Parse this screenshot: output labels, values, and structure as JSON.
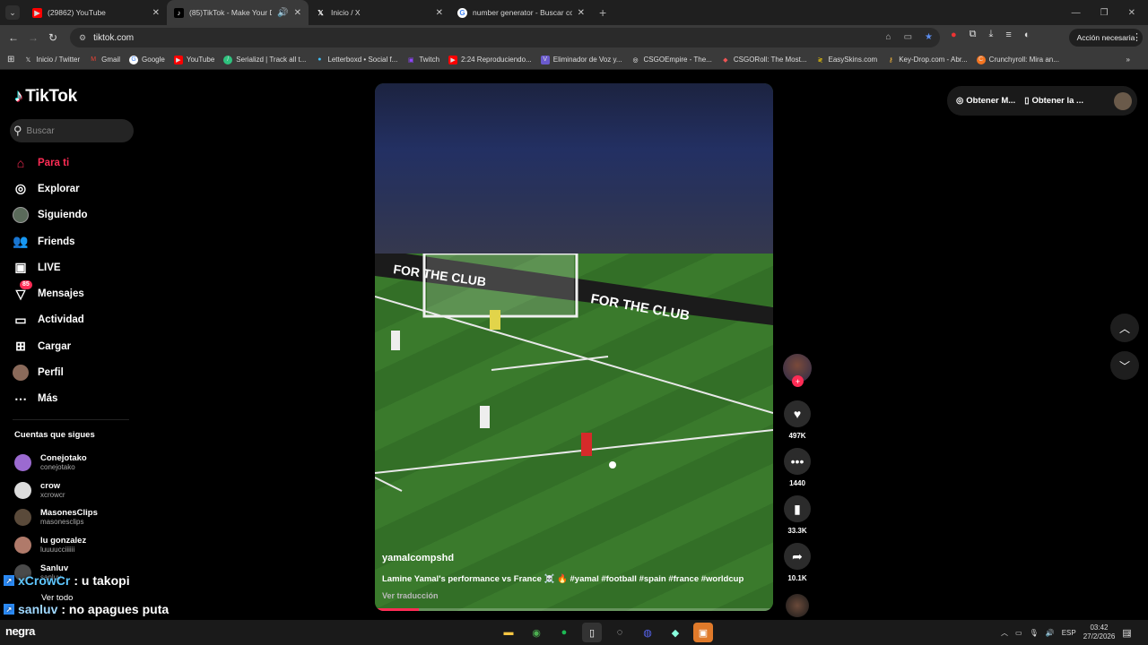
{
  "browser": {
    "tabs": [
      {
        "title": "(29862) YouTube",
        "icon": "youtube-icon",
        "active": false
      },
      {
        "title": "(85)TikTok - Make Your Day",
        "icon": "tiktok-icon",
        "active": true
      },
      {
        "title": "Inicio / X",
        "icon": "x-icon",
        "active": false
      },
      {
        "title": "number generator - Buscar con",
        "icon": "google-icon",
        "active": false
      }
    ],
    "url": "tiktok.com",
    "profile_button": "Acción necesaria",
    "bookmarks": [
      {
        "label": "Inicio / Twitter",
        "icon": "x-icon"
      },
      {
        "label": "Gmail",
        "icon": "gmail-icon"
      },
      {
        "label": "Google",
        "icon": "google-icon"
      },
      {
        "label": "YouTube",
        "icon": "youtube-icon"
      },
      {
        "label": "Serializd | Track all t...",
        "icon": "serializd-icon"
      },
      {
        "label": "Letterboxd • Social f...",
        "icon": "letterboxd-icon"
      },
      {
        "label": "Twitch",
        "icon": "twitch-icon"
      },
      {
        "label": "2:24 Reproduciendo...",
        "icon": "youtube-icon"
      },
      {
        "label": "Eliminador de Voz y...",
        "icon": "vocal-remover-icon"
      },
      {
        "label": "CSGOEmpire - The...",
        "icon": "csgoempire-icon"
      },
      {
        "label": "CSGORoll: The Most...",
        "icon": "csgoroll-icon"
      },
      {
        "label": "EasySkins.com",
        "icon": "easyskins-icon"
      },
      {
        "label": "Key-Drop.com - Abr...",
        "icon": "keydrop-icon"
      },
      {
        "label": "Crunchyroll: Mira an...",
        "icon": "crunchyroll-icon"
      }
    ]
  },
  "tiktok": {
    "logo": "TikTok",
    "search_placeholder": "Buscar",
    "nav": [
      {
        "label": "Para ti",
        "icon": "home-icon",
        "active": true
      },
      {
        "label": "Explorar",
        "icon": "compass-icon"
      },
      {
        "label": "Siguiendo",
        "icon": "following-avatar-icon"
      },
      {
        "label": "Friends",
        "icon": "friends-icon"
      },
      {
        "label": "LIVE",
        "icon": "live-icon"
      },
      {
        "label": "Mensajes",
        "icon": "messages-icon",
        "badge": "85"
      },
      {
        "label": "Actividad",
        "icon": "activity-icon"
      },
      {
        "label": "Cargar",
        "icon": "upload-icon"
      },
      {
        "label": "Perfil",
        "icon": "profile-avatar-icon"
      },
      {
        "label": "Más",
        "icon": "more-icon"
      }
    ],
    "following_title": "Cuentas que sigues",
    "following": [
      {
        "name": "Conejotako",
        "user": "conejotako",
        "color": "#9b6ad0"
      },
      {
        "name": "crow",
        "user": "xcrowcr",
        "color": "#dcdcdc"
      },
      {
        "name": "MasonesClips",
        "user": "masonesclips",
        "color": "#5a4a3a"
      },
      {
        "name": "lu gonzalez",
        "user": "luuuucciiiiii",
        "color": "#b07a6a"
      },
      {
        "name": "Sanluv",
        "user": "sanluv",
        "color": "#4a4a4a"
      }
    ],
    "see_all": "Ver todo",
    "top_right": {
      "get_coins": "Obtener M...",
      "get_app": "Obtener la ..."
    },
    "video": {
      "author": "yamalcompshd",
      "caption": "Lamine Yamal's performance vs France ☠️ 🔥 #yamal #football #spain #france #worldcup",
      "translate": "Ver traducción",
      "progress": 0.11,
      "likes": "497K",
      "comments": "1440",
      "saves": "33.3K",
      "shares": "10.1K"
    }
  },
  "overlay": {
    "line1_user": "xCrowCr",
    "line1_text": ": u takopi",
    "line2_user": "sanluv",
    "line2_text": ": no apagues puta"
  },
  "taskbar": {
    "label": "negra",
    "language": "ESP",
    "time": "03:42",
    "date": "27/2/2026",
    "notifications": "2"
  }
}
